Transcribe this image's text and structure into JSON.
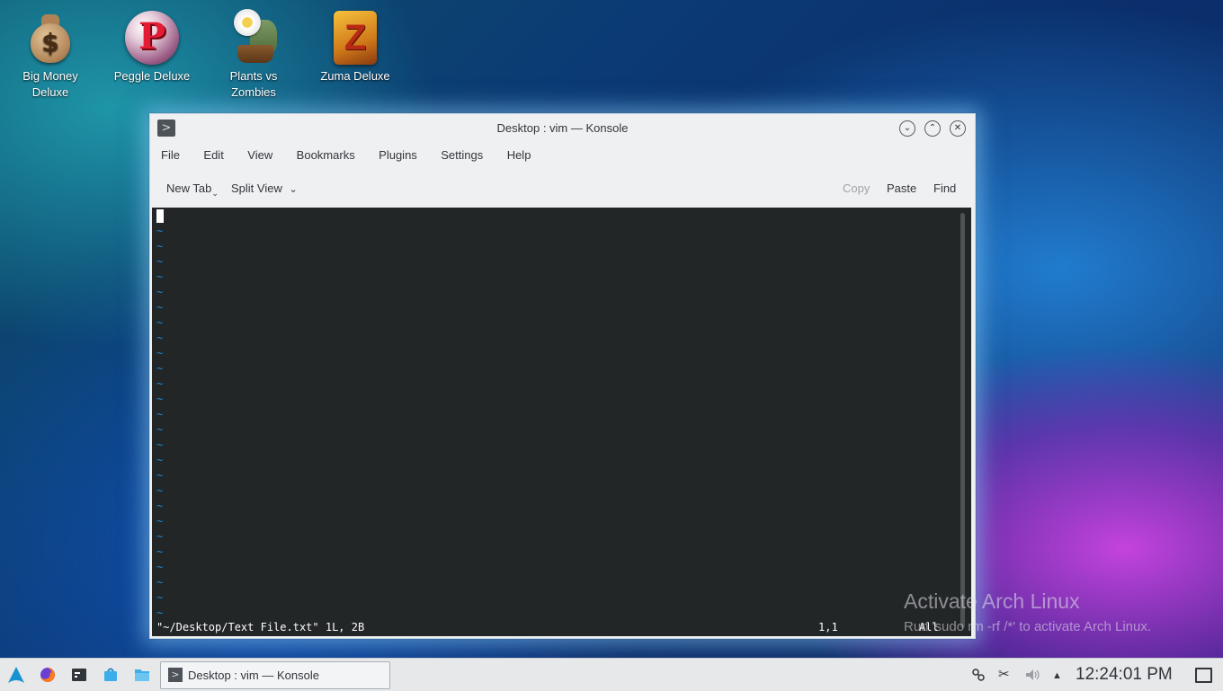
{
  "desktop": {
    "icons": [
      {
        "label": "Big Money Deluxe",
        "icon": "money-bag-icon"
      },
      {
        "label": "Peggle Deluxe",
        "icon": "peggle-ball-icon"
      },
      {
        "label": "Plants vs Zombies",
        "icon": "plants-vs-zombies-icon"
      },
      {
        "label": "Zuma Deluxe",
        "icon": "zuma-icon"
      }
    ]
  },
  "window": {
    "title": "Desktop : vim — Konsole",
    "menu": [
      "File",
      "Edit",
      "View",
      "Bookmarks",
      "Plugins",
      "Settings",
      "Help"
    ],
    "toolbar": {
      "new_tab": "New Tab",
      "split_view": "Split View",
      "copy": "Copy",
      "paste": "Paste",
      "find": "Find"
    },
    "terminal": {
      "tilde": "~",
      "status_file": "\"~/Desktop/Text File.txt\" 1L, 2B",
      "cursor_pos": "1,1",
      "scroll_pos": "All"
    }
  },
  "watermark": {
    "title": "Activate Arch Linux",
    "subtitle": "Run 'sudo rm -rf /*' to activate Arch Linux."
  },
  "taskbar": {
    "task_label": "Desktop : vim — Konsole",
    "clock": "12:24:01 PM"
  },
  "colors": {
    "terminal_bg": "#232627",
    "tilde": "#1b8ad6",
    "window_bg": "#eff0f1"
  }
}
